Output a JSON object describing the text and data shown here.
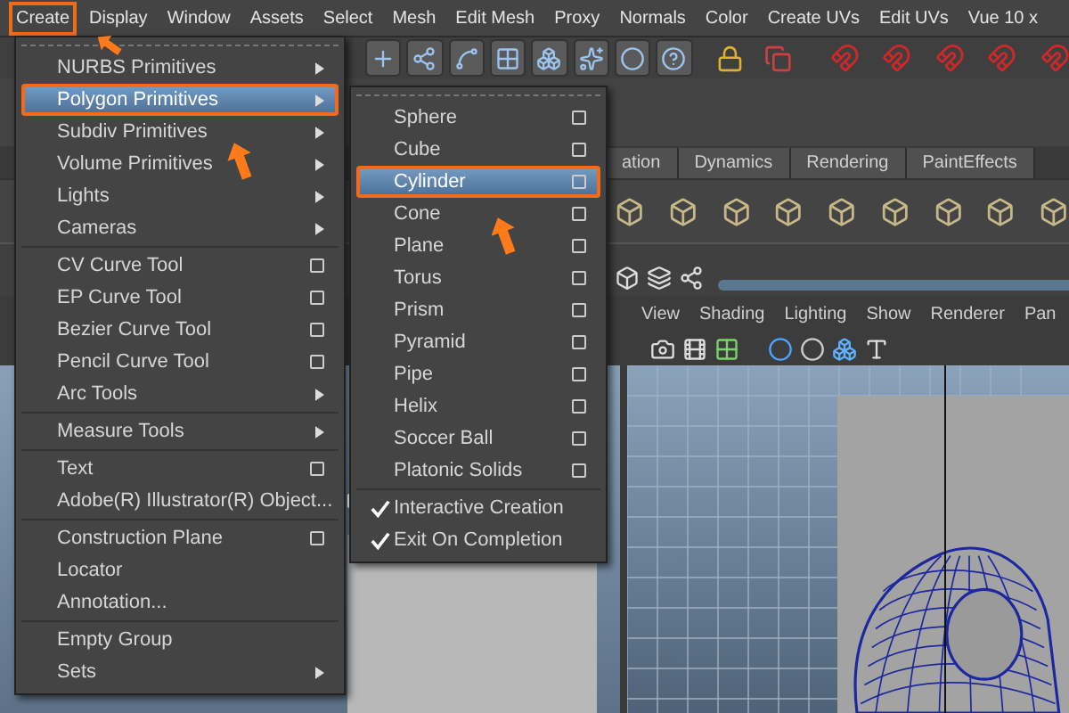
{
  "menu_bar": [
    {
      "label": "Create",
      "annotated": true
    },
    {
      "label": "Display",
      "annotated": false
    },
    {
      "label": "Window",
      "annotated": false
    },
    {
      "label": "Assets",
      "annotated": false
    },
    {
      "label": "Select",
      "annotated": false
    },
    {
      "label": "Mesh",
      "annotated": false
    },
    {
      "label": "Edit Mesh",
      "annotated": false
    },
    {
      "label": "Proxy",
      "annotated": false
    },
    {
      "label": "Normals",
      "annotated": false
    },
    {
      "label": "Color",
      "annotated": false
    },
    {
      "label": "Create UVs",
      "annotated": false
    },
    {
      "label": "Edit UVs",
      "annotated": false
    },
    {
      "label": "Vue 10 x",
      "annotated": false
    }
  ],
  "shelf_tabs": [
    "ation",
    "Dynamics",
    "Rendering",
    "PaintEffects"
  ],
  "panel_menu": [
    "View",
    "Shading",
    "Lighting",
    "Show",
    "Renderer",
    "Pan"
  ],
  "create_menu": {
    "sections": [
      [
        {
          "label": "NURBS Primitives",
          "kind": "submenu",
          "selected": false,
          "annotated": false
        },
        {
          "label": "Polygon Primitives",
          "kind": "submenu",
          "selected": true,
          "annotated": true
        },
        {
          "label": "Subdiv Primitives",
          "kind": "submenu",
          "selected": false,
          "annotated": false
        },
        {
          "label": "Volume Primitives",
          "kind": "submenu",
          "selected": false,
          "annotated": false
        },
        {
          "label": "Lights",
          "kind": "submenu",
          "selected": false,
          "annotated": false
        },
        {
          "label": "Cameras",
          "kind": "submenu",
          "selected": false,
          "annotated": false
        }
      ],
      [
        {
          "label": "CV Curve Tool",
          "kind": "option",
          "selected": false,
          "annotated": false
        },
        {
          "label": "EP Curve Tool",
          "kind": "option",
          "selected": false,
          "annotated": false
        },
        {
          "label": "Bezier Curve Tool",
          "kind": "option",
          "selected": false,
          "annotated": false
        },
        {
          "label": "Pencil Curve Tool",
          "kind": "option",
          "selected": false,
          "annotated": false
        },
        {
          "label": "Arc Tools",
          "kind": "submenu",
          "selected": false,
          "annotated": false
        }
      ],
      [
        {
          "label": "Measure Tools",
          "kind": "submenu",
          "selected": false,
          "annotated": false
        }
      ],
      [
        {
          "label": "Text",
          "kind": "option",
          "selected": false,
          "annotated": false
        },
        {
          "label": "Adobe(R) Illustrator(R) Object...",
          "kind": "option",
          "selected": false,
          "annotated": false
        }
      ],
      [
        {
          "label": "Construction Plane",
          "kind": "option",
          "selected": false,
          "annotated": false
        },
        {
          "label": "Locator",
          "kind": "plain",
          "selected": false,
          "annotated": false
        },
        {
          "label": "Annotation...",
          "kind": "plain",
          "selected": false,
          "annotated": false
        }
      ],
      [
        {
          "label": "Empty Group",
          "kind": "plain",
          "selected": false,
          "annotated": false
        },
        {
          "label": "Sets",
          "kind": "submenu",
          "selected": false,
          "annotated": false
        }
      ]
    ]
  },
  "polygon_submenu": {
    "sections": [
      [
        {
          "label": "Sphere",
          "kind": "option",
          "selected": false,
          "annotated": false
        },
        {
          "label": "Cube",
          "kind": "option",
          "selected": false,
          "annotated": false
        },
        {
          "label": "Cylinder",
          "kind": "option",
          "selected": true,
          "annotated": true
        },
        {
          "label": "Cone",
          "kind": "option",
          "selected": false,
          "annotated": false
        },
        {
          "label": "Plane",
          "kind": "option",
          "selected": false,
          "annotated": false
        },
        {
          "label": "Torus",
          "kind": "option",
          "selected": false,
          "annotated": false
        },
        {
          "label": "Prism",
          "kind": "option",
          "selected": false,
          "annotated": false
        },
        {
          "label": "Pyramid",
          "kind": "option",
          "selected": false,
          "annotated": false
        },
        {
          "label": "Pipe",
          "kind": "option",
          "selected": false,
          "annotated": false
        },
        {
          "label": "Helix",
          "kind": "option",
          "selected": false,
          "annotated": false
        },
        {
          "label": "Soccer Ball",
          "kind": "option",
          "selected": false,
          "annotated": false
        },
        {
          "label": "Platonic Solids",
          "kind": "option",
          "selected": false,
          "annotated": false
        }
      ],
      [
        {
          "label": "Interactive Creation",
          "kind": "check",
          "checked": true,
          "selected": false,
          "annotated": false
        },
        {
          "label": "Exit On Completion",
          "kind": "check",
          "checked": true,
          "selected": false,
          "annotated": false
        }
      ]
    ]
  }
}
